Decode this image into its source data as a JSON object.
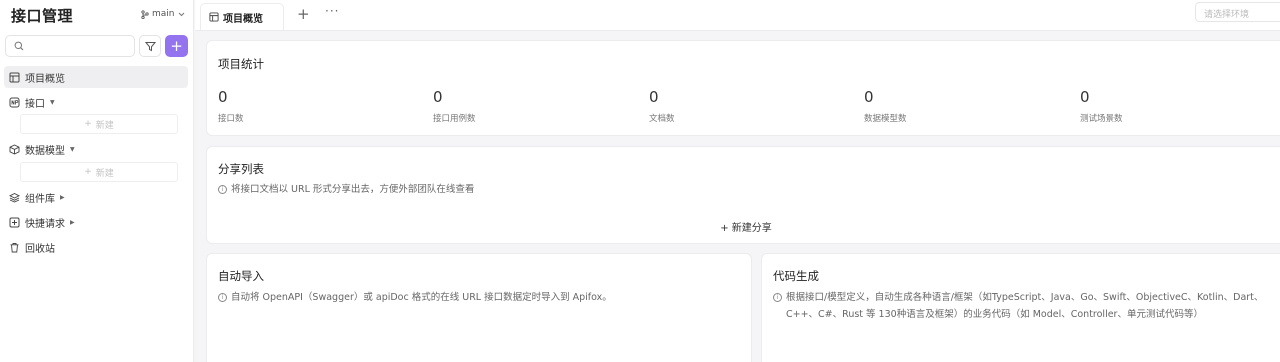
{
  "sidebar": {
    "title": "接口管理",
    "branch": "main",
    "search": {
      "placeholder": ""
    },
    "add_label": "+",
    "items": [
      {
        "label": "项目概览",
        "icon": "layout-icon",
        "active": true
      },
      {
        "label": "接口",
        "icon": "api-icon",
        "caret": "▼"
      },
      {
        "label": "数据模型",
        "icon": "cube-icon",
        "caret": "▼"
      },
      {
        "label": "组件库",
        "icon": "layers-icon",
        "caret": "▶"
      },
      {
        "label": "快捷请求",
        "icon": "request-icon",
        "caret": "▶"
      },
      {
        "label": "回收站",
        "icon": "trash-icon"
      }
    ],
    "new_label": "新建",
    "new_icon": "+"
  },
  "topbar": {
    "tab_label": "项目概览",
    "add_tab": "+",
    "more": "···",
    "env_placeholder": "请选择环境"
  },
  "stats": {
    "title": "项目统计",
    "items": [
      {
        "value": "0",
        "label": "接口数"
      },
      {
        "value": "0",
        "label": "接口用例数"
      },
      {
        "value": "0",
        "label": "文档数"
      },
      {
        "value": "0",
        "label": "数据模型数"
      },
      {
        "value": "0",
        "label": "测试场景数"
      }
    ]
  },
  "share": {
    "title": "分享列表",
    "hint": "将接口文档以 URL 形式分享出去，方便外部团队在线查看",
    "new_label": "+ 新建分享"
  },
  "import": {
    "title": "自动导入",
    "hint": "自动将 OpenAPI（Swagger）或 apiDoc 格式的在线 URL 接口数据定时导入到 Apifox。"
  },
  "codegen": {
    "title": "代码生成",
    "hint_line1": "根据接口/模型定义，自动生成各种语言/框架（如TypeScript、Java、Go、Swift、ObjectiveC、Kotlin、Dart、",
    "hint_line2": "C++、C#、Rust 等 130种语言及框架）的业务代码（如 Model、Controller、单元测试代码等）"
  },
  "info_glyph": "i",
  "colors": {
    "accent": "#9373ee",
    "active_bg": "#efeff2"
  }
}
